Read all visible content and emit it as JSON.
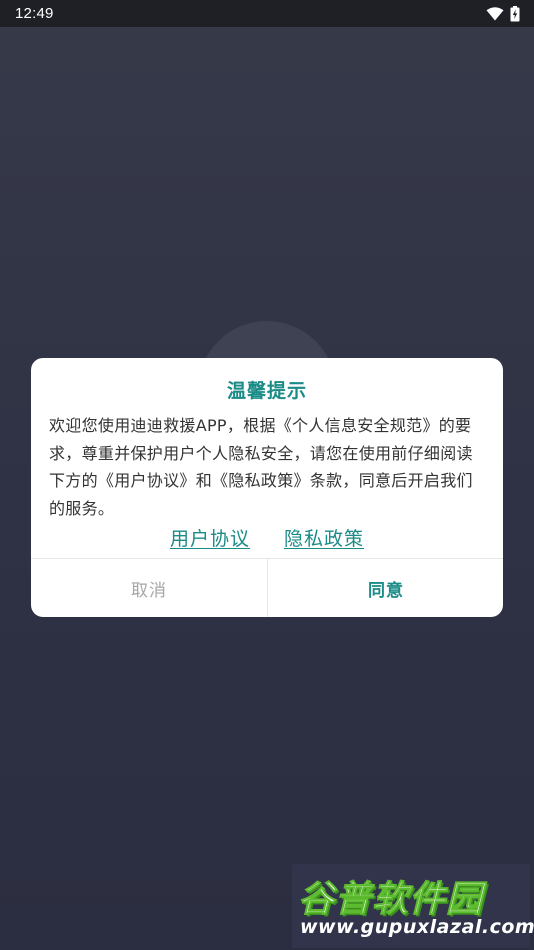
{
  "status_bar": {
    "time": "12:49",
    "icons": [
      "wifi-icon",
      "battery-charging-icon"
    ]
  },
  "dialog": {
    "title": "温馨提示",
    "body": "欢迎您使用迪迪救援APP，根据《个人信息安全规范》的要求，尊重并保护用户个人隐私安全，请您在使用前仔细阅读下方的《用户协议》和《隐私政策》条款，同意后开启我们的服务。",
    "links": {
      "user_agreement": "用户协议",
      "privacy_policy": "隐私政策"
    },
    "buttons": {
      "cancel": "取消",
      "agree": "同意"
    }
  },
  "watermark": {
    "title": "谷普软件园",
    "url": "www.gupuxlazal.com"
  },
  "colors": {
    "accent": "#1a8b86",
    "status_bar_bg": "#1f2026",
    "background": "#34374a",
    "cancel_text": "#a6a6a6"
  }
}
